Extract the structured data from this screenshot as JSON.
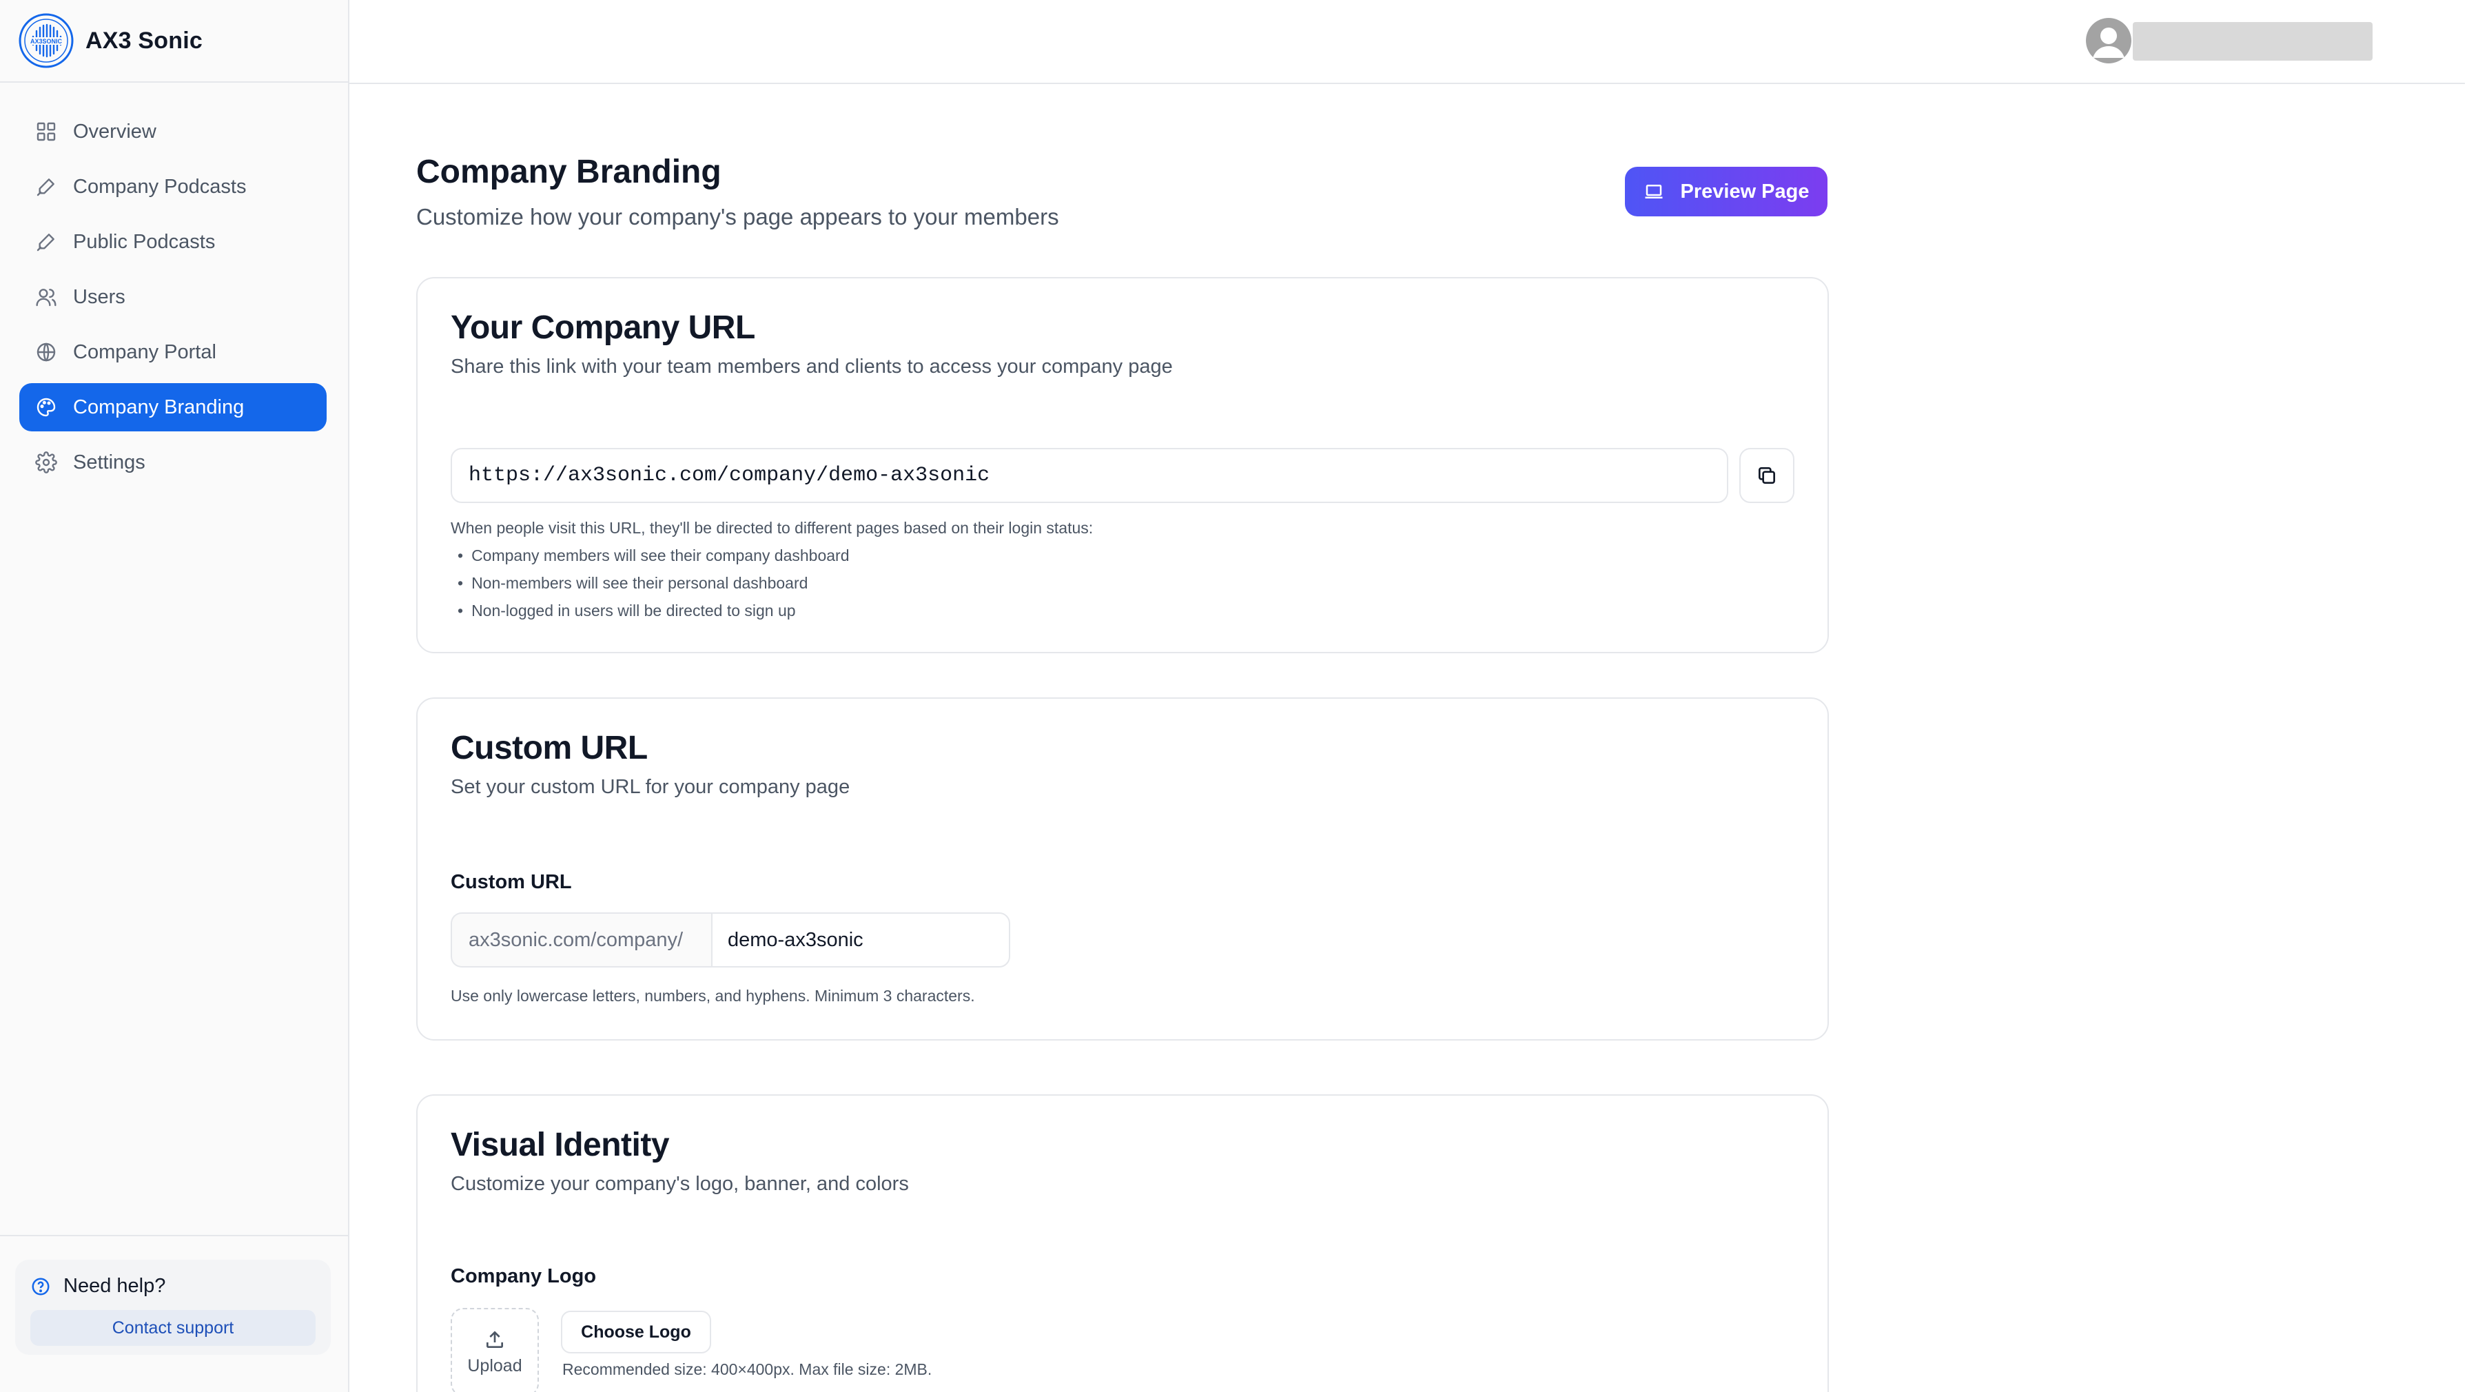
{
  "app": {
    "name": "AX3 Sonic",
    "logo_text": "AX3SONIC"
  },
  "sidebar": {
    "items": [
      {
        "label": "Overview",
        "icon": "grid-icon",
        "active": false
      },
      {
        "label": "Company Podcasts",
        "icon": "pen-icon",
        "active": false
      },
      {
        "label": "Public Podcasts",
        "icon": "pen-icon",
        "active": false
      },
      {
        "label": "Users",
        "icon": "users-icon",
        "active": false
      },
      {
        "label": "Company Portal",
        "icon": "globe-icon",
        "active": false
      },
      {
        "label": "Company Branding",
        "icon": "palette-icon",
        "active": true
      },
      {
        "label": "Settings",
        "icon": "gear-icon",
        "active": false
      }
    ],
    "help": {
      "title": "Need help?",
      "link": "Contact support"
    }
  },
  "header": {
    "title": "Company Branding",
    "subtitle": "Customize how your company's page appears to your members",
    "preview_button": "Preview Page"
  },
  "company_url": {
    "title": "Your Company URL",
    "description": "Share this link with your team members and clients to access your company page",
    "url": "https://ax3sonic.com/company/demo-ax3sonic",
    "info": "When people visit this URL, they'll be directed to different pages based on their login status:",
    "bullets": [
      "Company members will see their company dashboard",
      "Non-members will see their personal dashboard",
      "Non-logged in users will be directed to sign up"
    ]
  },
  "custom_url": {
    "title": "Custom URL",
    "description": "Set your custom URL for your company page",
    "label": "Custom URL",
    "prefix": "ax3sonic.com/company/",
    "value": "demo-ax3sonic",
    "hint": "Use only lowercase letters, numbers, and hyphens. Minimum 3 characters."
  },
  "visual_identity": {
    "title": "Visual Identity",
    "description": "Customize your company's logo, banner, and colors",
    "logo_label": "Company Logo",
    "upload_label": "Upload",
    "choose_button": "Choose Logo",
    "hint": "Recommended size: 400×400px. Max file size: 2MB."
  },
  "colors": {
    "accent": "#1467ea",
    "gradient_start": "#4f55f5",
    "gradient_end": "#7c3df0"
  }
}
